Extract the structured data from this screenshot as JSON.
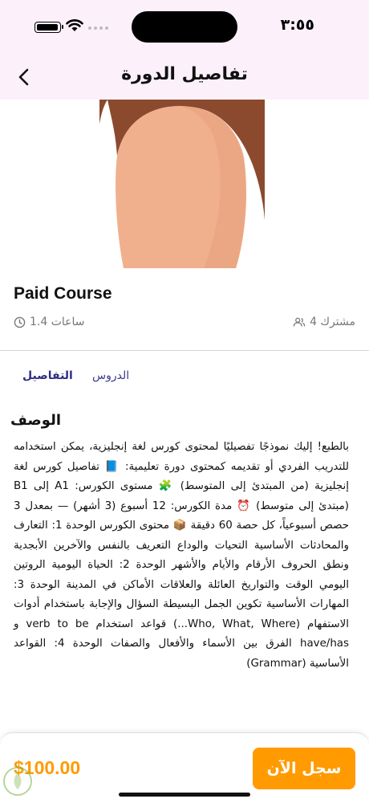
{
  "status_bar": {
    "time": "٣:٥٥"
  },
  "nav": {
    "title": "تفاصيل الدورة",
    "back_icon": "chevron-left-icon"
  },
  "course": {
    "title": "Paid Course",
    "duration": "ساعات 1.4",
    "participants": "مشترك 4"
  },
  "tabs": [
    {
      "label": "التفاصيل",
      "active": true
    },
    {
      "label": "الدروس",
      "active": false
    }
  ],
  "description": {
    "heading": "الوصف",
    "body": "بالطبع! إليك نموذجًا تفصيليًا لمحتوى كورس لغة إنجليزية، يمكن استخدامه للتدريب الفردي أو تقديمه كمحتوى دورة تعليمية: 📘 تفاصيل كورس لغة إنجليزية (من المبتدئ إلى المتوسط) 🧩 مستوى الكورس: A1 إلى B1 (مبتدئ إلى متوسط) ⏰ مدة الكورس: 12 أسبوع (3 أشهر) — بمعدل 3 حصص أسبوعياً، كل حصة 60 دقيقة 📦 محتوى الكورس الوحدة 1: التعارف والمحادثات الأساسية التحيات والوداع التعريف بالنفس والآخرين الأبجدية ونطق الحروف الأرقام والأيام والأشهر الوحدة 2: الحياة اليومية الروتين اليومي الوقت والتواريخ العائلة والعلاقات الأماكن في المدينة الوحدة 3: المهارات الأساسية تكوين الجمل البسيطة السؤال والإجابة باستخدام أدوات الاستفهام (Who, What, Where...) قواعد استخدام verb to be و have/has الفرق بين الأسماء والأفعال والصفات الوحدة 4: القواعد الأساسية (Grammar)"
  },
  "footer": {
    "price": "$100.00",
    "register_label": "سجل الآن"
  },
  "colors": {
    "accent": "#ff9b00",
    "tab_active": "#2f2d84",
    "header_bg": "#fcf1fb"
  }
}
